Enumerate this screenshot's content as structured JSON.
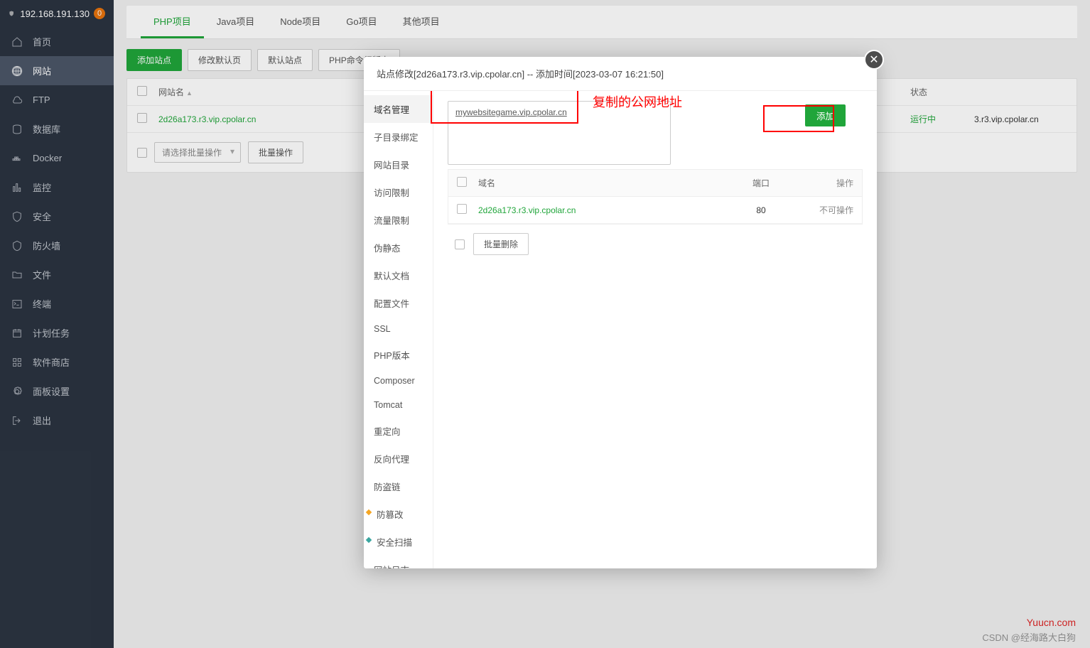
{
  "sidebar": {
    "ip": "192.168.191.130",
    "badge": "0",
    "items": [
      {
        "label": "首页",
        "icon": "home"
      },
      {
        "label": "网站",
        "icon": "globe",
        "active": true
      },
      {
        "label": "FTP",
        "icon": "cloud"
      },
      {
        "label": "数据库",
        "icon": "database"
      },
      {
        "label": "Docker",
        "icon": "docker"
      },
      {
        "label": "监控",
        "icon": "chart"
      },
      {
        "label": "安全",
        "icon": "shield"
      },
      {
        "label": "防火墙",
        "icon": "wall"
      },
      {
        "label": "文件",
        "icon": "folder"
      },
      {
        "label": "终端",
        "icon": "terminal"
      },
      {
        "label": "计划任务",
        "icon": "calendar"
      },
      {
        "label": "软件商店",
        "icon": "apps"
      },
      {
        "label": "面板设置",
        "icon": "gear"
      },
      {
        "label": "退出",
        "icon": "exit"
      }
    ]
  },
  "tabs": [
    "PHP项目",
    "Java项目",
    "Node项目",
    "Go项目",
    "其他项目"
  ],
  "active_tab": "PHP项目",
  "toolbar": {
    "add": "添加站点",
    "buttons": [
      "修改默认页",
      "默认站点",
      "PHP命令行版本"
    ]
  },
  "table": {
    "cols": {
      "name": "网站名",
      "status": "状态"
    },
    "row": {
      "name": "2d26a173.r3.vip.cpolar.cn",
      "status": "运行中",
      "right": "3.r3.vip.cpolar.cn"
    },
    "batch_placeholder": "请选择批量操作",
    "batch_btn": "批量操作"
  },
  "modal": {
    "title": "站点修改[2d26a173.r3.vip.cpolar.cn] -- 添加时间[2023-03-07 16:21:50]",
    "nav": [
      "域名管理",
      "子目录绑定",
      "网站目录",
      "访问限制",
      "流量限制",
      "伪静态",
      "默认文档",
      "配置文件",
      "SSL",
      "PHP版本",
      "Composer",
      "Tomcat",
      "重定向",
      "反向代理",
      "防盗链",
      "防篡改",
      "安全扫描",
      "网站日志"
    ],
    "nav_icons": {
      "15": "orange",
      "16": "teal"
    },
    "domain_input": "mywebsitegame.vip.cpolar.cn",
    "add_btn": "添加",
    "annotation": "复制的公网地址",
    "dom_head": {
      "domain": "域名",
      "port": "端口",
      "action": "操作"
    },
    "dom_row": {
      "domain": "2d26a173.r3.vip.cpolar.cn",
      "port": "80",
      "action": "不可操作"
    },
    "batch_del": "批量删除"
  },
  "footer": {
    "site": "Yuucn.com",
    "author": "CSDN @经海路大白狗"
  }
}
